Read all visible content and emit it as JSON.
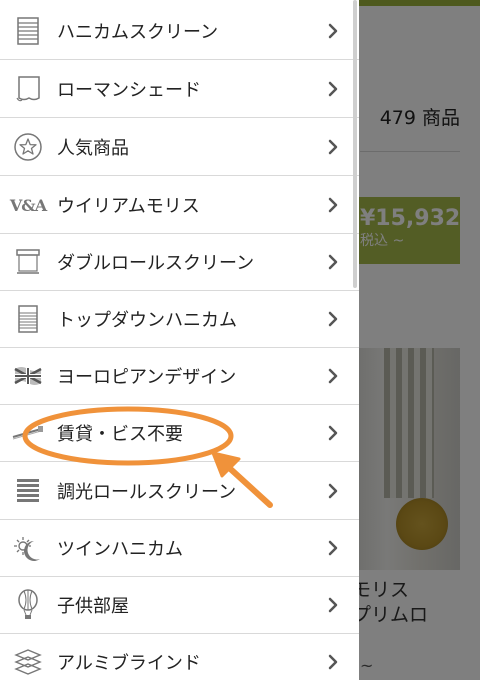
{
  "background": {
    "product_count": "479 商品",
    "price_main": "¥15,932",
    "price_sub": "税込 ~",
    "product_caption_1": "モリス",
    "product_caption_2": "プリムロ",
    "tilde": "~"
  },
  "menu": {
    "items": [
      {
        "label": "ハニカムスクリーン",
        "icon": "honeycomb-screen-icon"
      },
      {
        "label": "ローマンシェード",
        "icon": "roman-shade-icon"
      },
      {
        "label": "人気商品",
        "icon": "star-icon"
      },
      {
        "label": "ウイリアムモリス",
        "icon": "va-logo-icon"
      },
      {
        "label": "ダブルロールスクリーン",
        "icon": "double-roll-screen-icon"
      },
      {
        "label": "トップダウンハニカム",
        "icon": "top-down-honeycomb-icon"
      },
      {
        "label": "ヨーロピアンデザイン",
        "icon": "union-flag-icon"
      },
      {
        "label": "賃貸・ビス不要",
        "icon": "tension-rod-icon"
      },
      {
        "label": "調光ロールスクリーン",
        "icon": "dimming-roll-screen-icon"
      },
      {
        "label": "ツインハニカム",
        "icon": "sun-moon-icon"
      },
      {
        "label": "子供部屋",
        "icon": "balloon-icon"
      },
      {
        "label": "アルミブラインド",
        "icon": "aluminum-blind-icon"
      }
    ]
  },
  "colors": {
    "accent_green": "#9cb23a",
    "annotation_orange": "#f0923a",
    "overlay": "rgba(0,0,0,0.5)"
  }
}
